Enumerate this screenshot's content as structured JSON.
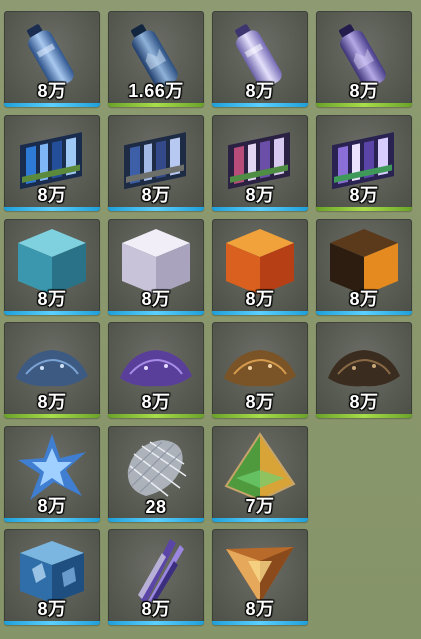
{
  "inventory": {
    "items": [
      {
        "name": "blue-water-bottle-icon",
        "qty": "8万",
        "bar": "blue"
      },
      {
        "name": "blue-crystal-bottle-icon",
        "qty": "1.66万",
        "bar": "green"
      },
      {
        "name": "violet-water-bottle-icon",
        "qty": "8万",
        "bar": "blue"
      },
      {
        "name": "purple-crystal-bottle-icon",
        "qty": "8万",
        "bar": "green"
      },
      {
        "name": "blue-circuit-board-icon",
        "qty": "8万",
        "bar": "blue"
      },
      {
        "name": "blue-circuit-module-icon",
        "qty": "8万",
        "bar": "blue"
      },
      {
        "name": "purple-circuit-board-icon",
        "qty": "8万",
        "bar": "blue"
      },
      {
        "name": "violet-circuit-module-icon",
        "qty": "8万",
        "bar": "green"
      },
      {
        "name": "teal-glitter-cube-icon",
        "qty": "8万",
        "bar": "blue"
      },
      {
        "name": "white-glitter-cube-icon",
        "qty": "8万",
        "bar": "blue"
      },
      {
        "name": "orange-glitter-cube-icon",
        "qty": "8万",
        "bar": "blue"
      },
      {
        "name": "dark-amber-glitter-cube-icon",
        "qty": "8万",
        "bar": "blue"
      },
      {
        "name": "blue-ore-pile-icon",
        "qty": "8万",
        "bar": "green"
      },
      {
        "name": "purple-ore-pile-icon",
        "qty": "8万",
        "bar": "green"
      },
      {
        "name": "brown-ore-pile-icon",
        "qty": "8万",
        "bar": "green"
      },
      {
        "name": "dark-ore-pile-icon",
        "qty": "8万",
        "bar": "green"
      },
      {
        "name": "blue-star-crystal-icon",
        "qty": "8万",
        "bar": "blue"
      },
      {
        "name": "silver-mesh-fragment-icon",
        "qty": "28",
        "bar": "blue"
      },
      {
        "name": "rainbow-pyramid-icon",
        "qty": "7万",
        "bar": "blue"
      },
      {
        "name": "blue-crystal-block-icon",
        "qty": "8万",
        "bar": "blue"
      },
      {
        "name": "purple-shard-cluster-icon",
        "qty": "8万",
        "bar": "blue"
      },
      {
        "name": "golden-prism-icon",
        "qty": "8万",
        "bar": "blue"
      }
    ]
  },
  "colors": {
    "background": "#8a976c",
    "slot": "#55584f",
    "blue_bar": "#3db8f0",
    "green_bar": "#8cc63a"
  }
}
